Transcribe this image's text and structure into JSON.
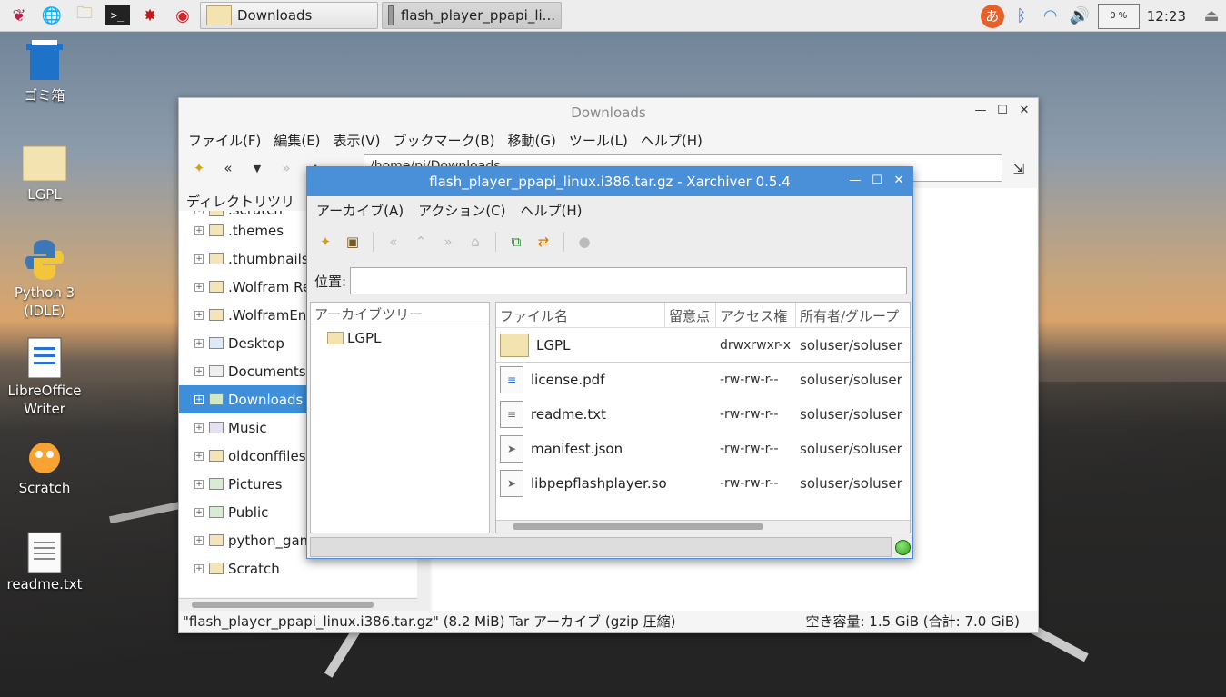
{
  "taskbar": {
    "tasks": [
      {
        "label": "Downloads"
      },
      {
        "label": "flash_player_ppapi_li..."
      }
    ],
    "cpu": "0 %",
    "clock": "12:23",
    "ime_label": "あ"
  },
  "desktop": {
    "icons": [
      {
        "label": "ゴミ箱"
      },
      {
        "label": "LGPL"
      },
      {
        "label": "Python 3 (IDLE)"
      },
      {
        "label": "LibreOffice Writer"
      },
      {
        "label": "Scratch"
      },
      {
        "label": "readme.txt"
      }
    ]
  },
  "filemanager": {
    "title": "Downloads",
    "menu": [
      "ファイル(F)",
      "編集(E)",
      "表示(V)",
      "ブックマーク(B)",
      "移動(G)",
      "ツール(L)",
      "ヘルプ(H)"
    ],
    "path": "/home/pi/Downloads",
    "side_header": "ディレクトリツリー",
    "tree": [
      {
        "label": ".scratch"
      },
      {
        "label": ".themes"
      },
      {
        "label": ".thumbnails"
      },
      {
        "label": ".Wolfram Re"
      },
      {
        "label": ".WolframEng"
      },
      {
        "label": "Desktop"
      },
      {
        "label": "Documents"
      },
      {
        "label": "Downloads"
      },
      {
        "label": "Music"
      },
      {
        "label": "oldconffiles"
      },
      {
        "label": "Pictures"
      },
      {
        "label": "Public"
      },
      {
        "label": "python_gam"
      },
      {
        "label": "Scratch"
      }
    ],
    "status_left": "\"flash_player_ppapi_linux.i386.tar.gz\" (8.2 MiB) Tar アーカイブ (gzip 圧縮)",
    "status_right": "空き容量: 1.5 GiB (合計: 7.0 GiB)"
  },
  "xarchiver": {
    "title": "flash_player_ppapi_linux.i386.tar.gz - Xarchiver 0.5.4",
    "menu": [
      "アーカイブ(A)",
      "アクション(C)",
      "ヘルプ(H)"
    ],
    "location_label": "位置:",
    "location_value": "",
    "tree_header": "アーカイブツリー",
    "tree_item": "LGPL",
    "columns": [
      "ファイル名",
      "留意点",
      "アクセス権",
      "所有者/グループ"
    ],
    "files": [
      {
        "name": "LGPL",
        "access": "drwxrwxr-x",
        "owner": "soluser/soluser",
        "icon": "folder-icon"
      },
      {
        "name": "license.pdf",
        "access": "-rw-rw-r--",
        "owner": "soluser/soluser",
        "icon": "pdf-icon"
      },
      {
        "name": "readme.txt",
        "access": "-rw-rw-r--",
        "owner": "soluser/soluser",
        "icon": "text-icon"
      },
      {
        "name": "manifest.json",
        "access": "-rw-rw-r--",
        "owner": "soluser/soluser",
        "icon": "script-icon"
      },
      {
        "name": "libpepflashplayer.so",
        "access": "-rw-rw-r--",
        "owner": "soluser/soluser",
        "icon": "script-icon"
      }
    ]
  }
}
